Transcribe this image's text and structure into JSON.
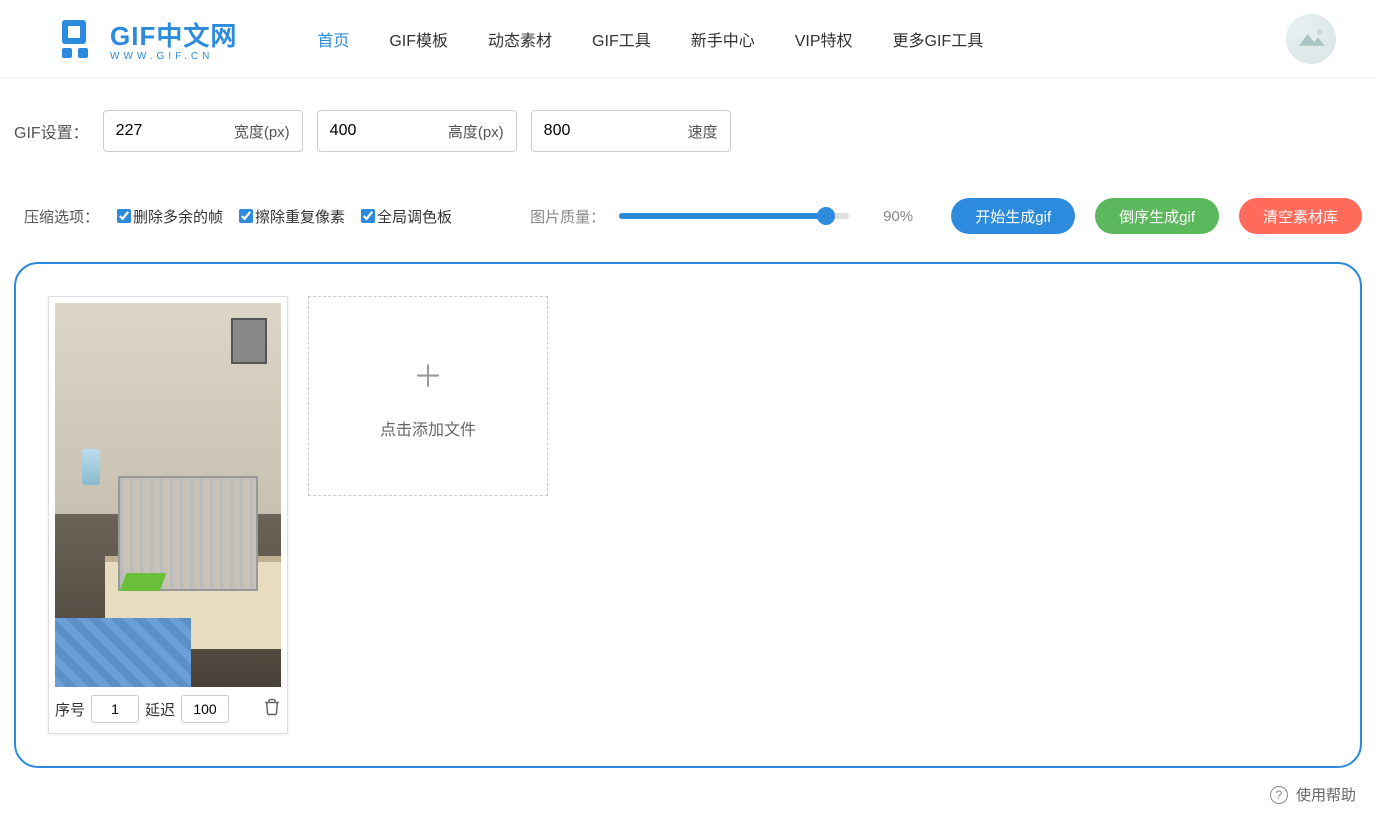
{
  "header": {
    "logo_main": "GIF中文网",
    "logo_sub": "WWW.GIF.CN",
    "nav": [
      "首页",
      "GIF模板",
      "动态素材",
      "GIF工具",
      "新手中心",
      "VIP特权",
      "更多GIF工具"
    ],
    "active_index": 0
  },
  "settings": {
    "label": "GIF设置：",
    "width_value": "227",
    "width_suffix": "宽度(px)",
    "height_value": "400",
    "height_suffix": "高度(px)",
    "speed_value": "800",
    "speed_suffix": "速度"
  },
  "compress": {
    "label": "压缩选项：",
    "opts": [
      {
        "label": "删除多余的帧",
        "checked": true
      },
      {
        "label": "擦除重复像素",
        "checked": true
      },
      {
        "label": "全局调色板",
        "checked": true
      }
    ]
  },
  "quality": {
    "label": "图片质量：",
    "percent": 90,
    "display": "90%"
  },
  "actions": {
    "generate": "开始生成gif",
    "reverse": "倒序生成gif",
    "clear": "清空素材库"
  },
  "frames": [
    {
      "order_label": "序号",
      "order_value": "1",
      "delay_label": "延迟",
      "delay_value": "100"
    }
  ],
  "add_card": {
    "label": "点击添加文件"
  },
  "footer": {
    "help": "使用帮助"
  }
}
